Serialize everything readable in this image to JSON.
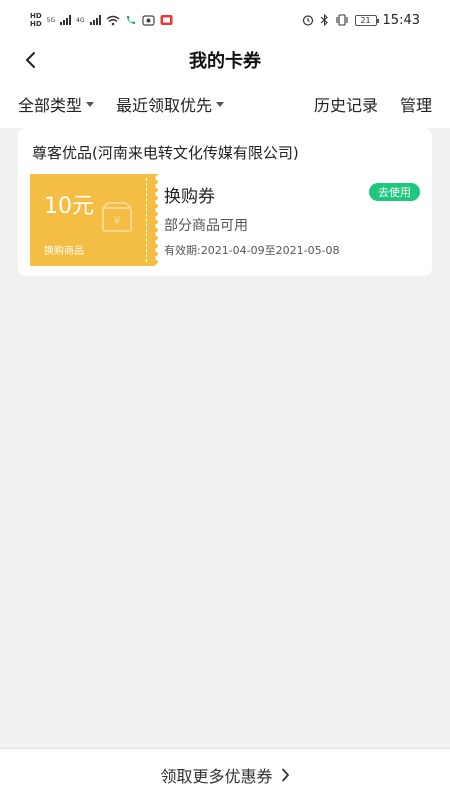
{
  "status_bar": {
    "net_left_top": "HD",
    "net_left_bottom": "HD",
    "gen1": "5G",
    "gen2": "4G",
    "battery": "21",
    "time": "15:43"
  },
  "header": {
    "title": "我的卡券"
  },
  "filters": {
    "type_label": "全部类型",
    "sort_label": "最近领取优先",
    "history_label": "历史记录",
    "manage_label": "管理"
  },
  "coupon": {
    "merchant": "尊客优品(河南来电转文化传媒有限公司)",
    "amount": "10元",
    "kind": "换购商品",
    "name": "换购券",
    "use_label": "去使用",
    "desc": "部分商品可用",
    "validity": "有效期:2021-04-09至2021-05-08",
    "ticket_color": "#f4bd43",
    "button_color": "#1ec77e"
  },
  "footer": {
    "more_label": "领取更多优惠券"
  }
}
